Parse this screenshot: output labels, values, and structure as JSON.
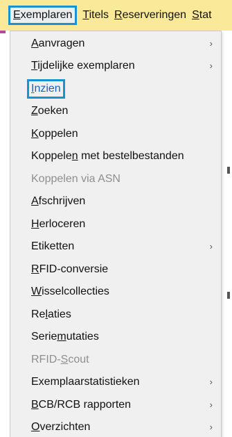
{
  "menubar": {
    "items": [
      {
        "pre": "",
        "key": "E",
        "post": "xemplaren"
      },
      {
        "pre": "",
        "key": "T",
        "post": "itels"
      },
      {
        "pre": "",
        "key": "R",
        "post": "eserveringen"
      },
      {
        "pre": "",
        "key": "S",
        "post": "tat"
      }
    ]
  },
  "menu": {
    "items": [
      {
        "pre": "",
        "key": "A",
        "post": "anvragen",
        "arrow": "›"
      },
      {
        "pre": "",
        "key": "T",
        "post": "ijdelijke exemplaren",
        "arrow": "›"
      },
      {
        "pre": "",
        "key": "I",
        "post": "nzien",
        "arrow": ""
      },
      {
        "pre": "",
        "key": "Z",
        "post": "oeken",
        "arrow": ""
      },
      {
        "pre": "",
        "key": "K",
        "post": "oppelen",
        "arrow": ""
      },
      {
        "pre": "Koppele",
        "key": "n",
        "post": " met bestelbestanden",
        "arrow": ""
      },
      {
        "pre": "Koppelen via ASN",
        "key": "",
        "post": "",
        "arrow": ""
      },
      {
        "pre": "",
        "key": "A",
        "post": "fschrijven",
        "arrow": ""
      },
      {
        "pre": "",
        "key": "H",
        "post": "erloceren",
        "arrow": ""
      },
      {
        "pre": "Etiketten",
        "key": "",
        "post": "",
        "arrow": "›"
      },
      {
        "pre": "",
        "key": "R",
        "post": "FID-conversie",
        "arrow": ""
      },
      {
        "pre": "",
        "key": "W",
        "post": "isselcollecties",
        "arrow": ""
      },
      {
        "pre": "Re",
        "key": "l",
        "post": "aties",
        "arrow": ""
      },
      {
        "pre": "Serie",
        "key": "m",
        "post": "utaties",
        "arrow": ""
      },
      {
        "pre": "RFID-",
        "key": "S",
        "post": "cout",
        "arrow": ""
      },
      {
        "pre": "Exemplaarstatistieken",
        "key": "",
        "post": "",
        "arrow": "›"
      },
      {
        "pre": "",
        "key": "B",
        "post": "CB/RCB rapporten",
        "arrow": "›"
      },
      {
        "pre": "",
        "key": "O",
        "post": "verzichten",
        "arrow": "›"
      }
    ]
  },
  "colors": {
    "menubar_bg": "#fbe99a",
    "highlight_border": "#1793d1",
    "highlight_text": "#1565c0",
    "disabled_text": "#8f8f8f"
  }
}
